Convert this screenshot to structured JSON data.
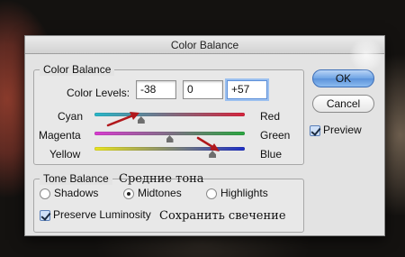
{
  "dialog": {
    "title": "Color Balance"
  },
  "color_balance": {
    "group_title": "Color Balance",
    "levels_label": "Color Levels:",
    "levels": [
      "-38",
      "0",
      "+57"
    ],
    "sliders": [
      {
        "left": "Cyan",
        "right": "Red",
        "value": -38
      },
      {
        "left": "Magenta",
        "right": "Green",
        "value": 0
      },
      {
        "left": "Yellow",
        "right": "Blue",
        "value": 57
      }
    ]
  },
  "tone_balance": {
    "group_title": "Tone Balance",
    "options": [
      "Shadows",
      "Midtones",
      "Highlights"
    ],
    "selected": "Midtones",
    "preserve_luminosity_label": "Preserve Luminosity",
    "preserve_luminosity_checked": true
  },
  "buttons": {
    "ok": "OK",
    "cancel": "Cancel"
  },
  "preview": {
    "label": "Preview",
    "checked": true
  },
  "annotations": {
    "midtones_note": "Средние тона",
    "preserve_note": "Сохранить свечение"
  },
  "colors": {
    "cyan_red": [
      "#27b7c9",
      "#d7243c"
    ],
    "magenta_green": [
      "#d83bd0",
      "#2aa63f"
    ],
    "yellow_blue": [
      "#e9e41f",
      "#1e2fc6"
    ],
    "arrow": "#b1181c",
    "accent": "#5b92da"
  }
}
